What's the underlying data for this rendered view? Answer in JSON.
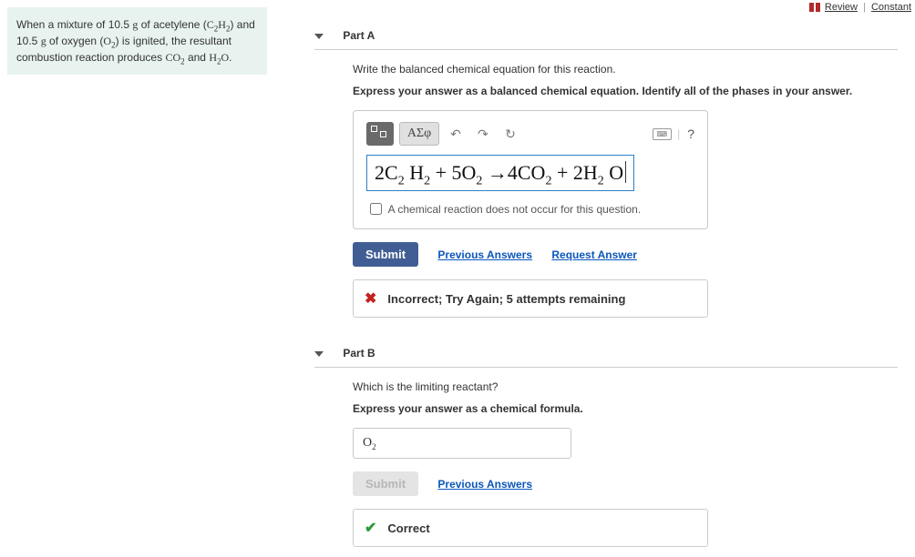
{
  "topLinks": {
    "review": "Review",
    "constants": "Constant"
  },
  "problemText": "When a mixture of 10.5 g of acetylene (C₂H₂) and 10.5 g of oxygen (O₂) is ignited, the resultant combustion reaction produces CO₂ and H₂O.",
  "partA": {
    "title": "Part A",
    "prompt": "Write the balanced chemical equation for this reaction.",
    "hint": "Express your answer as a balanced chemical equation. Identify all of the phases in your answer.",
    "toolbar": {
      "greek": "ΑΣφ",
      "undo": "↶",
      "redo": "↷",
      "reset": "↻",
      "kbd": "⌨",
      "help": "?"
    },
    "equationHTML": "2C<span class='eq-sub'>2</span> H<span class='eq-sub'>2</span>  + 5O<span class='eq-sub'>2</span> →4CO<span class='eq-sub'>2</span>  + 2H<span class='eq-sub'>2</span> O",
    "noOccurLabel": "A chemical reaction does not occur for this question.",
    "submit": "Submit",
    "prevAnswers": "Previous Answers",
    "requestAnswer": "Request Answer",
    "feedback": "Incorrect; Try Again; 5 attempts remaining"
  },
  "partB": {
    "title": "Part B",
    "prompt": "Which is the limiting reactant?",
    "hint": "Express your answer as a chemical formula.",
    "valueHTML": "O<sub>2</sub>",
    "submit": "Submit",
    "prevAnswers": "Previous Answers",
    "feedback": "Correct"
  }
}
